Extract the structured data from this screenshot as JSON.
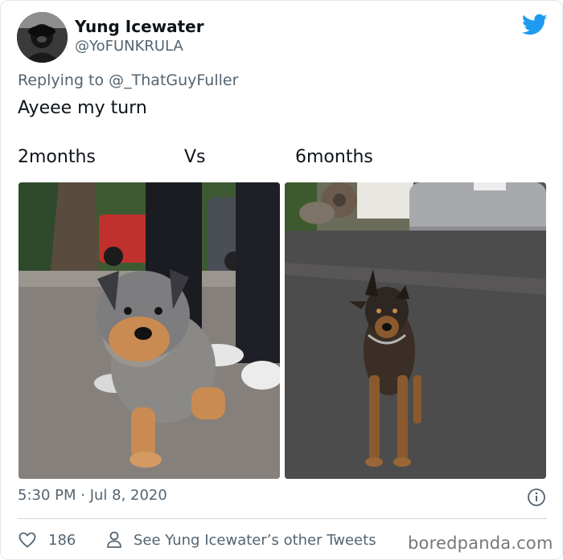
{
  "author": {
    "display_name": "Yung Icewater",
    "handle": "@YoFUNKRULA"
  },
  "reply": {
    "prefix": "Replying to ",
    "mention": "@_ThatGuyFuller"
  },
  "tweet": {
    "line1": "Ayeee my turn",
    "caption_left": "2months",
    "caption_mid": "Vs",
    "caption_right": "6months"
  },
  "meta": {
    "timestamp": "5:30 PM · Jul 8, 2020",
    "like_count": "186",
    "other_tweets_label": "See Yung Icewater’s other Tweets"
  },
  "watermark": "boredpanda.com",
  "colors": {
    "twitter_blue": "#1d9bf0",
    "secondary_text": "#536471",
    "primary_text": "#0f1419"
  },
  "icons": {
    "brand": "twitter-bird-icon",
    "info": "info-icon",
    "like": "heart-icon",
    "profile": "person-icon"
  }
}
